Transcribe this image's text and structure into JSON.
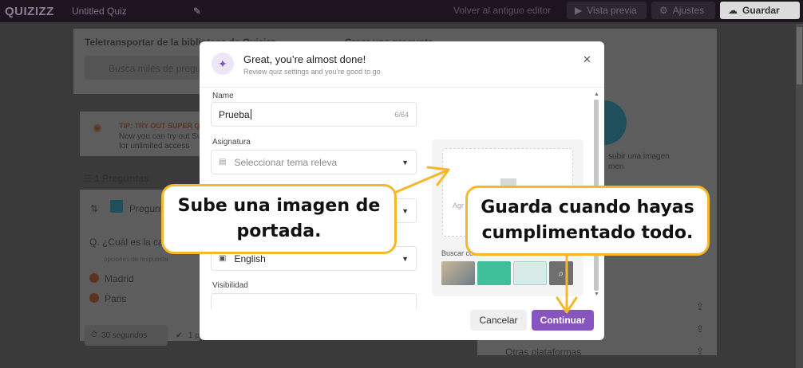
{
  "topbar": {
    "logo": "QUIZIZZ",
    "quiz_title": "Untitled Quiz",
    "old_editor": "Volver al antiguo editor",
    "preview_label": "Vista previa",
    "settings_label": "Ajustes",
    "save_label": "Guardar"
  },
  "background": {
    "library_title": "Teletransportar de la biblioteca de Quizizz",
    "create_question": "Crear una pregunta",
    "search_placeholder": "Busca miles de preguntas",
    "tip_title": "TIP: TRY OUT SUPER QUIZ",
    "tip_line1": "Now you can try out Su",
    "tip_line2": "for unlimited access",
    "questions_count": "1 Preguntas",
    "question_type": "Pregunta",
    "question_text": "Q. ¿Cuál es la capital",
    "answer_options": "opciones de respuesta",
    "answer_1": "Madrid",
    "answer_2": "Paris",
    "time": "30 segundos",
    "points": "1 p",
    "upload_image_1": "subir una imagen",
    "upload_image_2": "men",
    "other_platforms": "Otras plataformas"
  },
  "modal": {
    "title": "Great, you’re almost done!",
    "subtitle": "Review quiz settings and you’re good to go",
    "name_label": "Name",
    "name_value": "Prueba",
    "name_count": "6/64",
    "subject_label": "Asignatura",
    "subject_placeholder": "Seleccionar tema releva",
    "language_value": "English",
    "visibility_label": "Visibilidad",
    "image_drop_text": "Agr",
    "search_with": "Buscar con",
    "cancel_label": "Cancelar",
    "continue_label": "Continuar"
  },
  "callouts": {
    "left_line1": "Sube una imagen de",
    "left_line2": "portada.",
    "right_line1": "Guarda cuando hayas",
    "right_line2": "cumplimentado todo."
  },
  "colors": {
    "accent": "#8854c0",
    "callout_border": "#f5b72c",
    "arrow": "#f5b72c"
  }
}
